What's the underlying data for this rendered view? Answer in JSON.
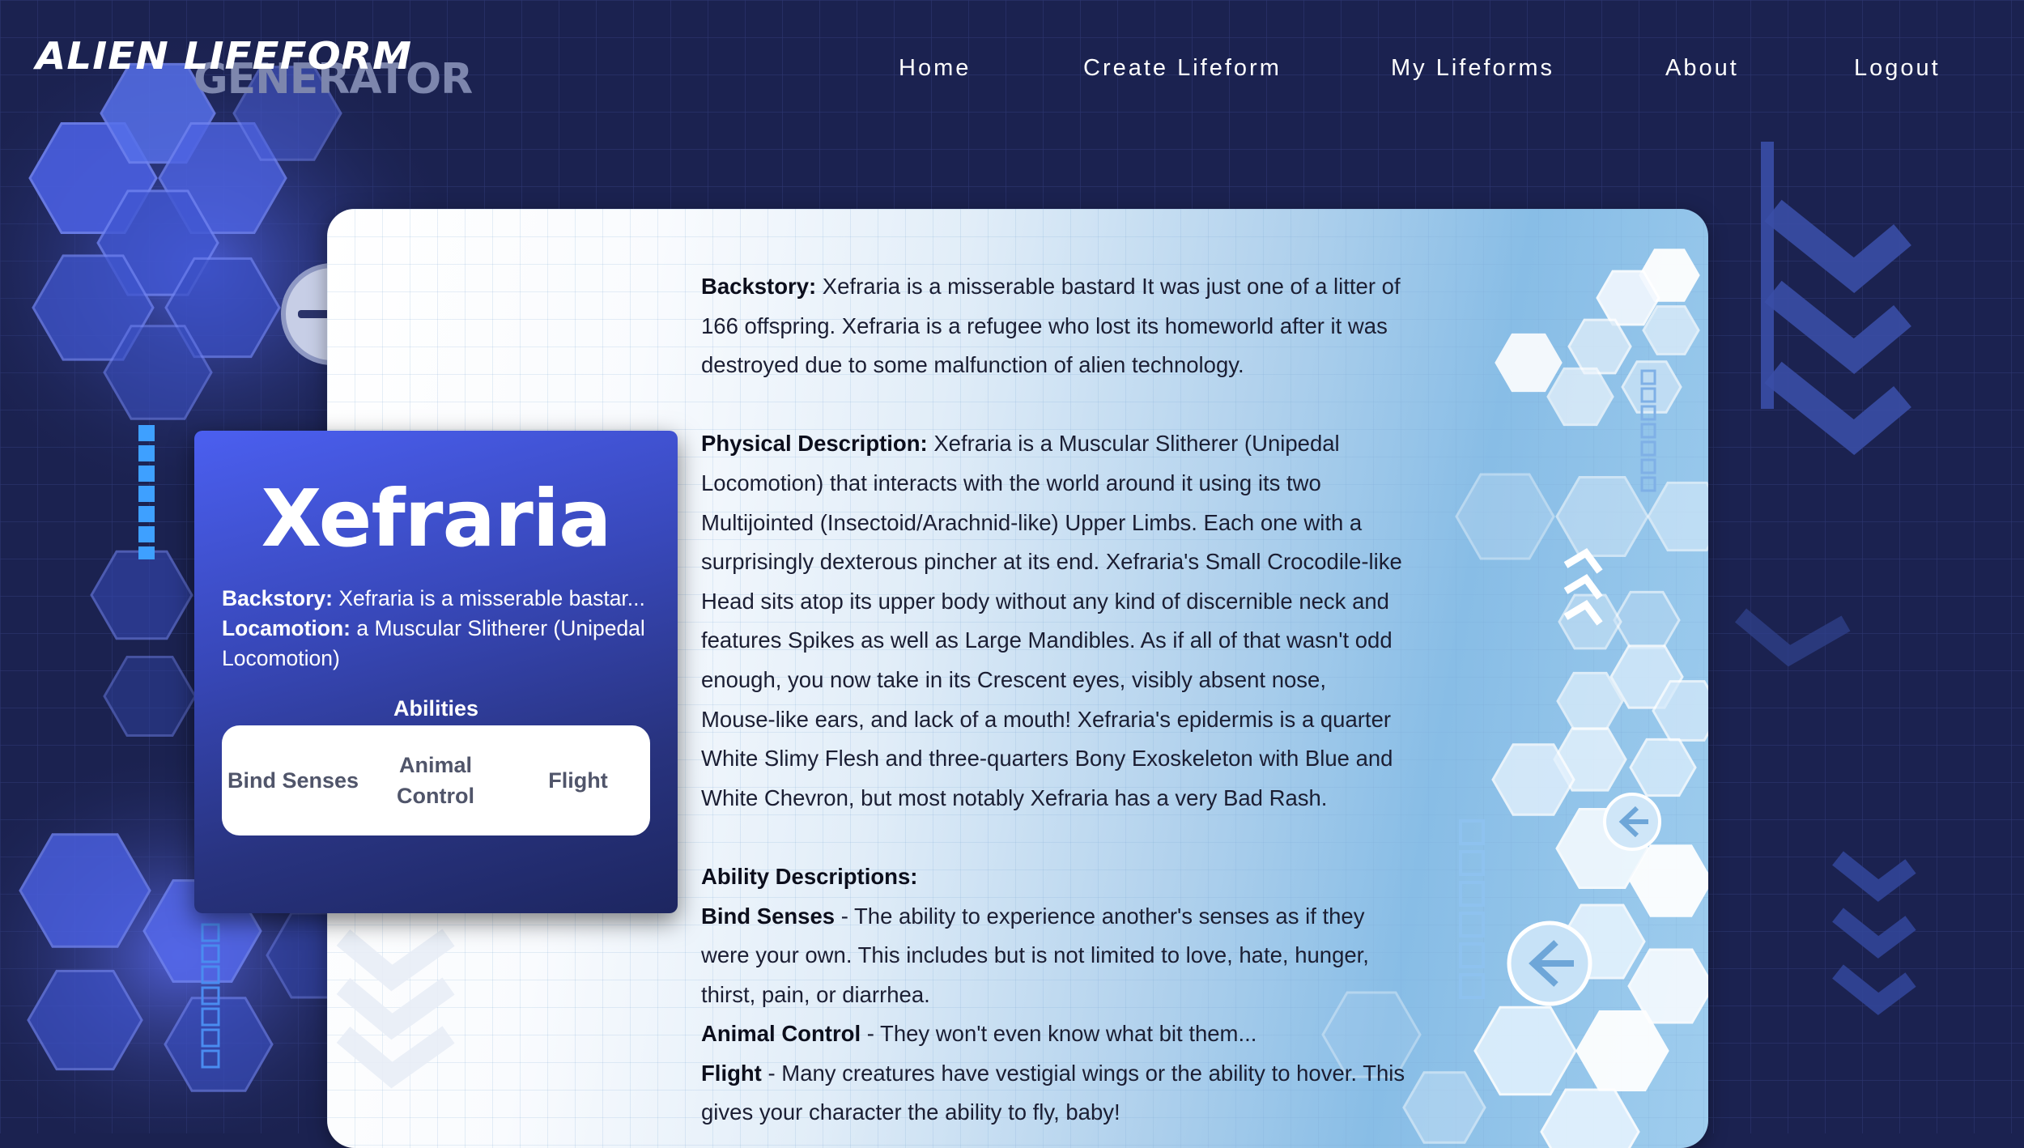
{
  "app": {
    "logo_line1": "ALIEN LIFEFORM",
    "logo_line2": "GENERATOR"
  },
  "nav": {
    "home": "Home",
    "create": "Create Lifeform",
    "my": "My Lifeforms",
    "about": "About",
    "logout": "Logout"
  },
  "card": {
    "name": "Xefraria",
    "backstory_label": "Backstory:",
    "backstory_short": "Xefraria is a misserable bastar...",
    "locomotion_label": "Locamotion:",
    "locomotion": "a Muscular Slitherer (Unipedal Locomotion)",
    "abilities_title": "Abilities",
    "abilities": [
      "Bind Senses",
      "Animal Control",
      "Flight"
    ]
  },
  "details": {
    "backstory_label": "Backstory:",
    "backstory": "Xefraria is a misserable bastard It was just one of a litter of 166 offspring. Xefraria is a refugee who lost its homeworld after it was destroyed due to some malfunction of alien technology.",
    "physical_label": "Physical Description:",
    "physical": "Xefraria is a Muscular Slitherer (Unipedal Locomotion) that interacts with the world around it using its two Multijointed (Insectoid/Arachnid-like) Upper Limbs. Each one with a surprisingly dexterous pincher at its end. Xefraria's Small Crocodile-like Head sits atop its upper body without any kind of discernible neck and features Spikes as well as Large Mandibles. As if all of that wasn't odd enough, you now take in its Crescent eyes, visibly absent nose, Mouse-like ears, and lack of a mouth! Xefraria's epidermis is a quarter White Slimy Flesh and three-quarters Bony Exoskeleton with Blue and White Chevron, but most notably Xefraria has a very Bad Rash.",
    "ability_desc_label": "Ability Descriptions:",
    "ability1_name": "Bind Senses",
    "ability1_desc": " - The ability to experience another's senses as if they were your own. This includes but is not limited to love, hate, hunger, thirst, pain, or diarrhea.",
    "ability2_name": "Animal Control",
    "ability2_desc": " - They won't even know what bit them...",
    "ability3_name": "Flight",
    "ability3_desc": " - Many creatures have vestigial wings or the ability to hover. This gives your character the ability to fly, baby!"
  },
  "colors": {
    "background": "#1b2250",
    "card_gradient_top": "#4b5ff0",
    "card_gradient_bottom": "#1d2660",
    "panel_accent": "#88bde6",
    "hex_blue": "#3f55d6"
  },
  "icons": [
    "back-arrow-icon",
    "chevron-icon",
    "minus-icon"
  ]
}
